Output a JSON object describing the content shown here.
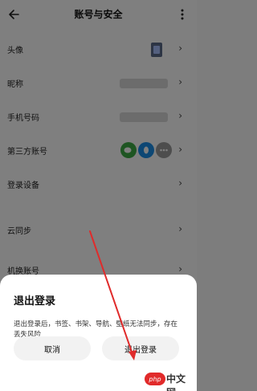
{
  "header": {
    "title": "账号与安全"
  },
  "rows": [
    {
      "label": "头像"
    },
    {
      "label": "昵称"
    },
    {
      "label": "手机号码"
    },
    {
      "label": "第三方账号"
    },
    {
      "label": "登录设备"
    },
    {
      "label": "云同步"
    },
    {
      "label": "机换账号"
    }
  ],
  "third_party_icons": [
    {
      "name": "wechat-icon",
      "color": "#3dab44"
    },
    {
      "name": "qq-icon",
      "color": "#1b8fe8"
    },
    {
      "name": "more-dots-icon",
      "color": "#9a9a9a"
    }
  ],
  "dialog": {
    "title": "退出登录",
    "message": "退出登录后，书签、书架、导航、壁纸无法同步，存在丢失风险",
    "cancel_label": "取消",
    "confirm_label": "退出登录"
  },
  "watermark": {
    "badge": "php",
    "text": "中文网"
  },
  "colors": {
    "annotation_arrow": "#e02b2b",
    "overlay": "#000000"
  }
}
